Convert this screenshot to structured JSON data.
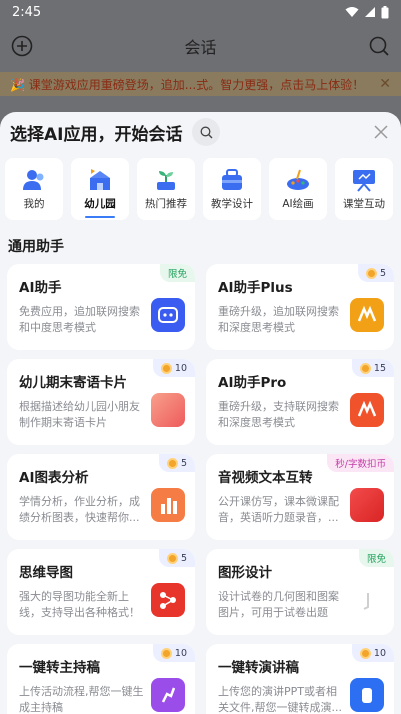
{
  "status": {
    "time": "2:45"
  },
  "appbar": {
    "title": "会话"
  },
  "banner": {
    "text": "🎉 课堂游戏应用重磅登场，追加...式。智力更强，点击马上体验！",
    "close": "✕"
  },
  "sheet": {
    "title": "选择AI应用，开始会话"
  },
  "categories": [
    {
      "label": "我的",
      "icon": "person-icon"
    },
    {
      "label": "幼儿园",
      "icon": "kindergarten-icon"
    },
    {
      "label": "热门推荐",
      "icon": "sprout-icon"
    },
    {
      "label": "教学设计",
      "icon": "toolbox-icon"
    },
    {
      "label": "AI绘画",
      "icon": "palette-icon"
    },
    {
      "label": "课堂互动",
      "icon": "projector-icon"
    }
  ],
  "section": {
    "title": "通用助手"
  },
  "cards": [
    {
      "title": "AI助手",
      "desc": "免费应用，追加联网搜索和中度思考模式",
      "tag": "限免",
      "tag_type": "free",
      "logo_color": "#3b5cf0"
    },
    {
      "title": "AI助手Plus",
      "desc": "重磅升级，追加联网搜索和深度思考模式",
      "tag": "5",
      "tag_type": "coin",
      "logo_color": "#f2a117"
    },
    {
      "title": "幼儿期末寄语卡片",
      "desc": "根据描述给幼儿园小朋友制作期末寄语卡片",
      "tag": "10",
      "tag_type": "coin",
      "logo_color": "#f07a6a"
    },
    {
      "title": "AI助手Pro",
      "desc": "重磅升级，支持联网搜索和深度思考模式",
      "tag": "15",
      "tag_type": "coin",
      "logo_color": "#f0532b"
    },
    {
      "title": "AI图表分析",
      "desc": "学情分析，作业分析，成绩分析图表，快速帮你...",
      "tag": "5",
      "tag_type": "coin",
      "logo_color": "#f57c45"
    },
    {
      "title": "音视频文本互转",
      "desc": "公开课仿写，课本微课配音，英语听力题录音，...",
      "tag": "秒/字数扣币",
      "tag_type": "pink",
      "logo_color": "#ef3a3a"
    },
    {
      "title": "思维导图",
      "desc": "强大的导图功能全新上线，支持导出各种格式！",
      "tag": "5",
      "tag_type": "coin",
      "logo_color": "#e8352c"
    },
    {
      "title": "图形设计",
      "desc": "设计试卷的几何图和图案图片，可用于试卷出题",
      "tag": "限免",
      "tag_type": "free",
      "logo_color": "#dcdcdc"
    },
    {
      "title": "一键转主持稿",
      "desc": "上传活动流程,帮您一键生成主持稿",
      "tag": "10",
      "tag_type": "coin",
      "logo_color": "#9b4dea"
    },
    {
      "title": "一键转演讲稿",
      "desc": "上传您的演讲PPT或者相关文件,帮您一键转成演...",
      "tag": "10",
      "tag_type": "coin",
      "logo_color": "#2d6ff2"
    }
  ]
}
